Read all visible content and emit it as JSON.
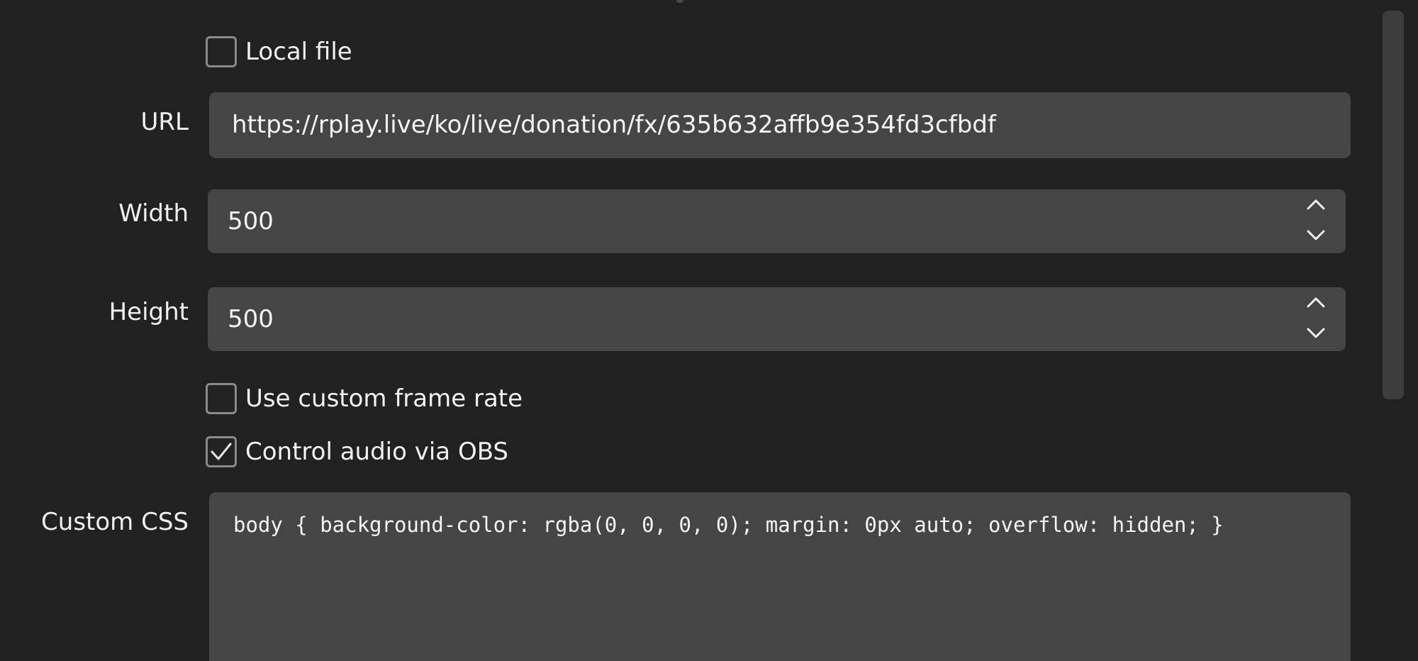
{
  "browser_source_properties": {
    "local_file": {
      "label": "Local file",
      "checked": false
    },
    "url": {
      "label": "URL",
      "value": "https://rplay.live/ko/live/donation/fx/635b632affb9e354fd3cfbdf"
    },
    "width": {
      "label": "Width",
      "value": "500"
    },
    "height": {
      "label": "Height",
      "value": "500"
    },
    "custom_frame_rate": {
      "label": "Use custom frame rate",
      "checked": false
    },
    "control_audio": {
      "label": "Control audio via OBS",
      "checked": true
    },
    "custom_css": {
      "label": "Custom CSS",
      "value": "body { background-color: rgba(0, 0, 0, 0); margin: 0px auto; overflow: hidden; }"
    }
  },
  "icons": {
    "checkmark": "checkmark-icon",
    "spin_up": "chevron-up-icon",
    "spin_down": "chevron-down-icon"
  },
  "colors": {
    "background": "#212121",
    "field": "#454545",
    "text": "#f2f2f2",
    "checkbox_border": "#8a8a8a"
  }
}
